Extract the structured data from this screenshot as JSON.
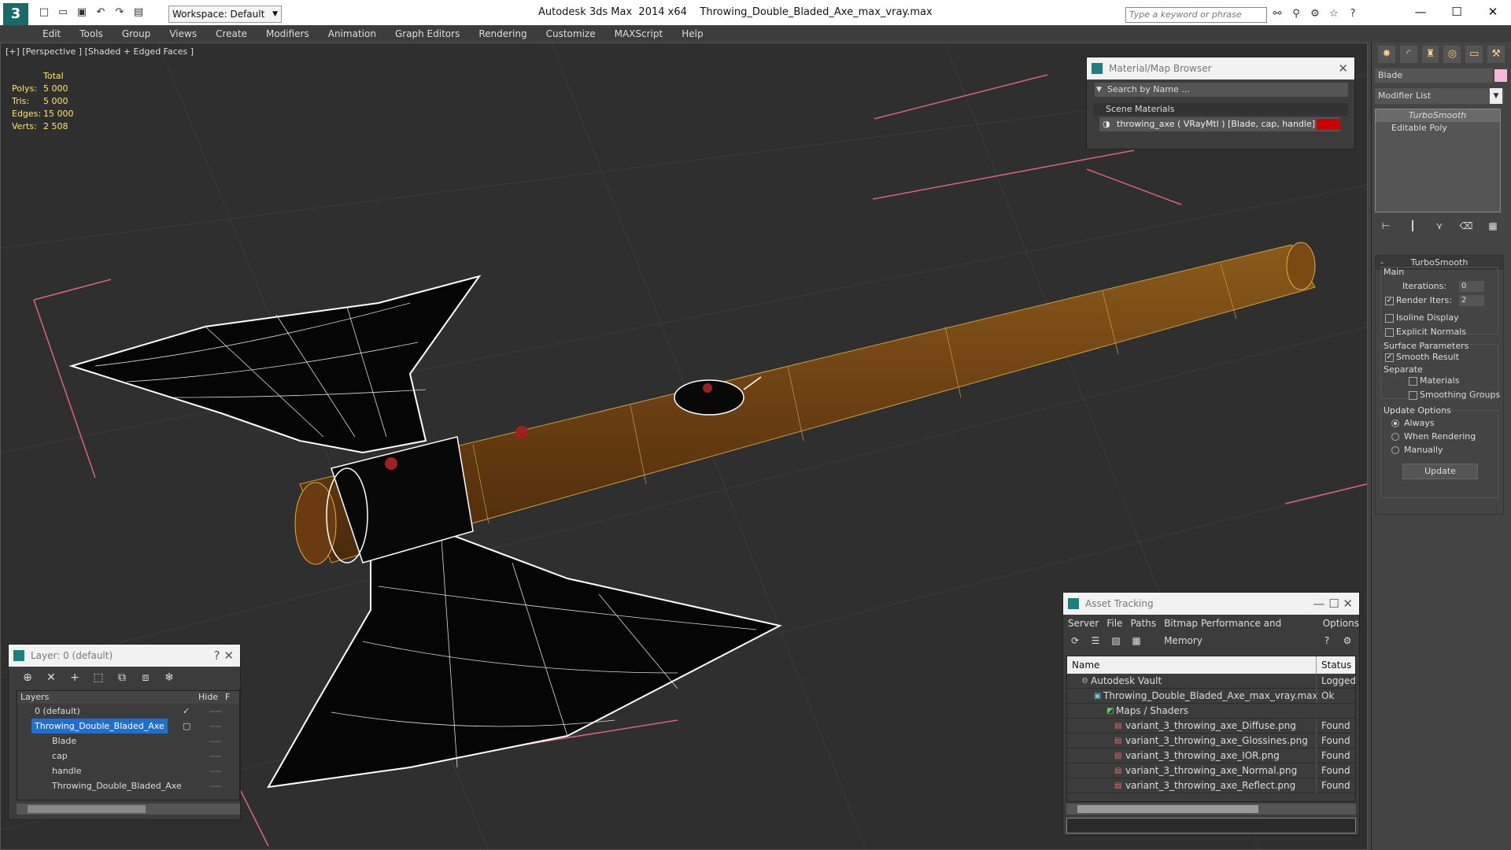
{
  "titlebar": {
    "workspace": "Workspace: Default",
    "app_title": "Autodesk 3ds Max  2014 x64",
    "file_title": "Throwing_Double_Bladed_Axe_max_vray.max",
    "search_placeholder": "Type a keyword or phrase"
  },
  "menu": [
    "Edit",
    "Tools",
    "Group",
    "Views",
    "Create",
    "Modifiers",
    "Animation",
    "Graph Editors",
    "Rendering",
    "Customize",
    "MAXScript",
    "Help"
  ],
  "viewport": {
    "label": "[+] [Perspective ] [Shaded + Edged Faces ]",
    "stats": {
      "header": "Total",
      "rows": [
        {
          "k": "Polys:",
          "v": "5 000"
        },
        {
          "k": "Tris:",
          "v": "5 000"
        },
        {
          "k": "Edges:",
          "v": "15 000"
        },
        {
          "k": "Verts:",
          "v": "2 508"
        }
      ]
    }
  },
  "material_browser": {
    "title": "Material/Map Browser",
    "search": "Search by Name ...",
    "section": "Scene Materials",
    "material": "throwing_axe  ( VRayMtl )  [Blade, cap, handle]",
    "swatch_color": "#cc0000"
  },
  "command_panel": {
    "object_name": "Blade",
    "object_color": "#f4b8d8",
    "modifier_list": "Modifier List",
    "stack": [
      "TurboSmooth",
      "Editable Poly"
    ],
    "turbosmooth": {
      "title": "TurboSmooth",
      "main": "Main",
      "iterations_label": "Iterations:",
      "iterations": "0",
      "render_iters_label": "Render Iters:",
      "render_iters": "2",
      "isoline": "Isoline Display",
      "explicit": "Explicit Normals",
      "surface": "Surface Parameters",
      "smooth_result": "Smooth Result",
      "separate": "Separate",
      "materials": "Materials",
      "smoothing_groups": "Smoothing Groups",
      "update_options": "Update Options",
      "always": "Always",
      "when_rendering": "When Rendering",
      "manually": "Manually",
      "update_button": "Update"
    }
  },
  "layer_panel": {
    "title": "Layer: 0 (default)",
    "col_layers": "Layers",
    "col_hide": "Hide",
    "col_f": "F",
    "rows": [
      {
        "name": "0 (default)",
        "indent": 18
      },
      {
        "name": "Throwing_Double_Bladed_Axe",
        "indent": 18
      },
      {
        "name": "Blade",
        "indent": 40
      },
      {
        "name": "cap",
        "indent": 40
      },
      {
        "name": "handle",
        "indent": 40
      },
      {
        "name": "Throwing_Double_Bladed_Axe",
        "indent": 40
      }
    ]
  },
  "asset_tracking": {
    "title": "Asset Tracking",
    "menu": [
      "Server",
      "File",
      "Paths",
      "Bitmap Performance and Memory",
      "Options"
    ],
    "col_name": "Name",
    "col_status": "Status",
    "rows": [
      {
        "name": "Autodesk Vault",
        "status": "Logged O",
        "indent": 30
      },
      {
        "name": "Throwing_Double_Bladed_Axe_max_vray.max",
        "status": "Ok",
        "indent": 46
      },
      {
        "name": "Maps / Shaders",
        "status": "",
        "indent": 62
      },
      {
        "name": "variant_3_throwing_axe_Diffuse.png",
        "status": "Found",
        "indent": 74
      },
      {
        "name": "variant_3_throwing_axe_Glossines.png",
        "status": "Found",
        "indent": 74
      },
      {
        "name": "variant_3_throwing_axe_IOR.png",
        "status": "Found",
        "indent": 74
      },
      {
        "name": "variant_3_throwing_axe_Normal.png",
        "status": "Found",
        "indent": 74
      },
      {
        "name": "variant_3_throwing_axe_Reflect.png",
        "status": "Found",
        "indent": 74
      }
    ]
  }
}
